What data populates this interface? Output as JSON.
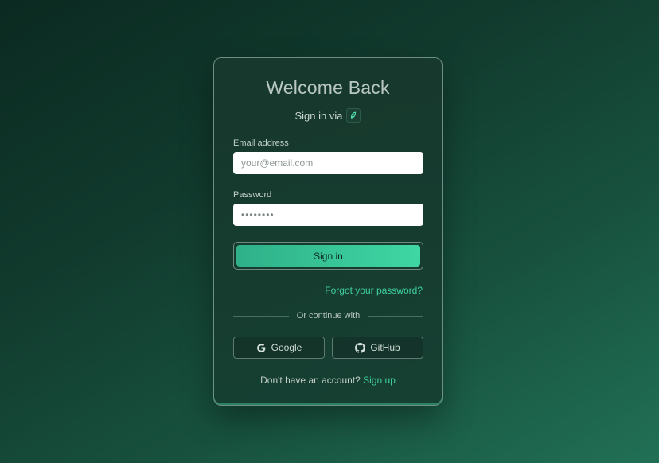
{
  "login": {
    "title": "Welcome Back",
    "subtitle": "Sign in via",
    "brand_icon": "leaf-icon",
    "email": {
      "label": "Email address",
      "placeholder": "your@email.com",
      "value": ""
    },
    "password": {
      "label": "Password",
      "value": "••••••••"
    },
    "signin_label": "Sign in",
    "forgot_label": "Forgot your password?",
    "divider_text": "Or continue with",
    "social": [
      {
        "label": "Google",
        "icon": "google-icon"
      },
      {
        "label": "GitHub",
        "icon": "github-icon"
      }
    ],
    "footer_text": "Don't have an account?",
    "signup_label": "Sign up"
  },
  "colors": {
    "accent": "#3fd0a0",
    "button_start": "#2fb088",
    "button_end": "#3fd7a4",
    "background_dark": "#0b2a21",
    "background_light": "#217055"
  }
}
